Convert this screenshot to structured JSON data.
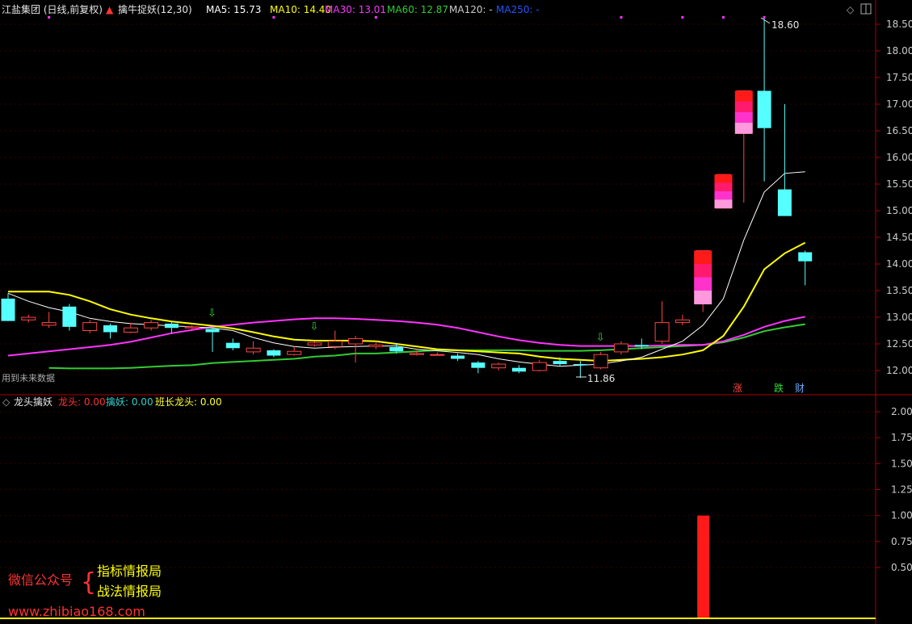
{
  "header": {
    "stock_title": "江盐集团 (日线,前复权)",
    "indicator_name": "擒牛捉妖(12,30)",
    "ma": [
      {
        "label": "MA5: 15.73",
        "color": "#ffffff"
      },
      {
        "label": "MA10: 14.40",
        "color": "#ffff00"
      },
      {
        "label": "MA30: 13.01",
        "color": "#ff33ff"
      },
      {
        "label": "MA60: 12.87",
        "color": "#33cc33"
      },
      {
        "label": "MA120: -",
        "color": "#cccccc"
      },
      {
        "label": "MA250: -",
        "color": "#2255ff"
      }
    ]
  },
  "main_panel": {
    "note": "用到未来数据",
    "high_label": "18.60",
    "low_label": "11.86",
    "tags": [
      {
        "text": "涨",
        "color": "#ff4444"
      },
      {
        "text": "跌",
        "color": "#33dd33"
      },
      {
        "text": "财",
        "color": "#66aaff"
      }
    ]
  },
  "sub_panel": {
    "title": "龙头擒妖",
    "items": [
      {
        "label": "龙头: 0.00",
        "color": "#ff3333"
      },
      {
        "label": "擒妖: 0.00",
        "color": "#33cccc"
      },
      {
        "label": "班长龙头: 0.00",
        "color": "#ffff33"
      }
    ]
  },
  "watermark": {
    "left_text": "微信公众号",
    "line1": "指标情报局",
    "line2": "战法情报局",
    "url": "www.zhibiao168.com"
  },
  "colors": {
    "up": "#ff4444",
    "down": "#55ffff",
    "border": "#aa0000",
    "axis_text": "#cccccc"
  },
  "chart_data": [
    {
      "type": "candlestick",
      "ylim": [
        11.7,
        18.75
      ],
      "yticks": [
        "12.00",
        "12.50",
        "13.00",
        "13.50",
        "14.00",
        "14.50",
        "15.00",
        "15.50",
        "16.00",
        "16.50",
        "17.00",
        "17.50",
        "18.00",
        "18.50"
      ],
      "candles": [
        {
          "o": 13.35,
          "h": 13.45,
          "l": 12.95,
          "c": 12.93
        },
        {
          "o": 12.95,
          "h": 13.05,
          "l": 12.9,
          "c": 13.0
        },
        {
          "o": 12.85,
          "h": 13.1,
          "l": 12.8,
          "c": 12.9
        },
        {
          "o": 13.2,
          "h": 13.25,
          "l": 12.75,
          "c": 12.82
        },
        {
          "o": 12.75,
          "h": 12.95,
          "l": 12.7,
          "c": 12.9
        },
        {
          "o": 12.85,
          "h": 12.88,
          "l": 12.6,
          "c": 12.72
        },
        {
          "o": 12.72,
          "h": 12.9,
          "l": 12.7,
          "c": 12.8
        },
        {
          "o": 12.8,
          "h": 12.95,
          "l": 12.75,
          "c": 12.9
        },
        {
          "o": 12.88,
          "h": 12.92,
          "l": 12.7,
          "c": 12.8
        },
        {
          "o": 12.8,
          "h": 12.85,
          "l": 12.78,
          "c": 12.82
        },
        {
          "o": 12.78,
          "h": 12.8,
          "l": 12.35,
          "c": 12.72
        },
        {
          "o": 12.52,
          "h": 12.6,
          "l": 12.38,
          "c": 12.42
        },
        {
          "o": 12.35,
          "h": 12.55,
          "l": 12.3,
          "c": 12.42
        },
        {
          "o": 12.38,
          "h": 12.4,
          "l": 12.25,
          "c": 12.28
        },
        {
          "o": 12.3,
          "h": 12.45,
          "l": 12.28,
          "c": 12.36
        },
        {
          "o": 12.48,
          "h": 12.55,
          "l": 12.45,
          "c": 12.52
        },
        {
          "o": 12.45,
          "h": 12.75,
          "l": 12.4,
          "c": 12.55
        },
        {
          "o": 12.5,
          "h": 12.65,
          "l": 12.15,
          "c": 12.6
        },
        {
          "o": 12.45,
          "h": 12.55,
          "l": 12.4,
          "c": 12.48
        },
        {
          "o": 12.44,
          "h": 12.5,
          "l": 12.32,
          "c": 12.36
        },
        {
          "o": 12.3,
          "h": 12.38,
          "l": 12.28,
          "c": 12.32
        },
        {
          "o": 12.3,
          "h": 12.34,
          "l": 12.28,
          "c": 12.3
        },
        {
          "o": 12.28,
          "h": 12.32,
          "l": 12.18,
          "c": 12.22
        },
        {
          "o": 12.15,
          "h": 12.18,
          "l": 11.95,
          "c": 12.05
        },
        {
          "o": 12.05,
          "h": 12.15,
          "l": 12.0,
          "c": 12.12
        },
        {
          "o": 12.05,
          "h": 12.1,
          "l": 11.95,
          "c": 11.98
        },
        {
          "o": 12.0,
          "h": 12.2,
          "l": 11.98,
          "c": 12.15
        },
        {
          "o": 12.18,
          "h": 12.25,
          "l": 12.08,
          "c": 12.12
        },
        {
          "o": 12.12,
          "h": 12.18,
          "l": 11.86,
          "c": 12.1
        },
        {
          "o": 12.05,
          "h": 12.35,
          "l": 12.02,
          "c": 12.3
        },
        {
          "o": 12.35,
          "h": 12.55,
          "l": 12.3,
          "c": 12.5
        },
        {
          "o": 12.48,
          "h": 12.6,
          "l": 12.4,
          "c": 12.45
        },
        {
          "o": 12.55,
          "h": 13.3,
          "l": 12.5,
          "c": 12.9
        },
        {
          "o": 12.9,
          "h": 13.05,
          "l": 12.85,
          "c": 12.95
        },
        {
          "o": 13.25,
          "h": 14.25,
          "l": 13.1,
          "c": 14.25
        },
        {
          "o": 15.05,
          "h": 15.68,
          "l": 15.05,
          "c": 15.68
        },
        {
          "o": 16.45,
          "h": 17.25,
          "l": 15.15,
          "c": 17.25
        },
        {
          "o": 17.25,
          "h": 18.6,
          "l": 15.55,
          "c": 16.55
        },
        {
          "o": 15.4,
          "h": 17.0,
          "l": 14.9,
          "c": 14.9
        },
        {
          "o": 14.22,
          "h": 14.25,
          "l": 13.6,
          "c": 14.05
        }
      ],
      "ma5": [
        13.45,
        13.3,
        13.18,
        13.1,
        12.98,
        12.92,
        12.88,
        12.86,
        12.84,
        12.82,
        12.8,
        12.75,
        12.62,
        12.52,
        12.45,
        12.42,
        12.44,
        12.45,
        12.46,
        12.46,
        12.4,
        12.37,
        12.34,
        12.3,
        12.22,
        12.16,
        12.12,
        12.08,
        12.1,
        12.12,
        12.18,
        12.25,
        12.4,
        12.55,
        12.85,
        13.35,
        14.45,
        15.35,
        15.7,
        15.73
      ],
      "ma10": [
        13.48,
        13.48,
        13.48,
        13.42,
        13.3,
        13.15,
        13.05,
        12.98,
        12.92,
        12.88,
        12.84,
        12.79,
        12.72,
        12.64,
        12.58,
        12.56,
        12.56,
        12.56,
        12.55,
        12.5,
        12.45,
        12.4,
        12.38,
        12.36,
        12.34,
        12.32,
        12.26,
        12.22,
        12.2,
        12.18,
        12.2,
        12.22,
        12.25,
        12.3,
        12.38,
        12.65,
        13.2,
        13.9,
        14.2,
        14.4
      ],
      "ma30": [
        12.28,
        12.32,
        12.36,
        12.4,
        12.44,
        12.48,
        12.54,
        12.62,
        12.7,
        12.76,
        12.82,
        12.86,
        12.9,
        12.93,
        12.96,
        12.98,
        12.98,
        12.97,
        12.95,
        12.93,
        12.9,
        12.86,
        12.8,
        12.72,
        12.64,
        12.57,
        12.52,
        12.48,
        12.46,
        12.46,
        12.46,
        12.46,
        12.47,
        12.48,
        12.48,
        12.55,
        12.67,
        12.82,
        12.93,
        13.01
      ],
      "ma60": [
        null,
        null,
        12.05,
        12.04,
        12.04,
        12.04,
        12.05,
        12.07,
        12.09,
        12.1,
        12.14,
        12.16,
        12.18,
        12.2,
        12.22,
        12.26,
        12.28,
        12.32,
        12.32,
        12.34,
        12.36,
        12.38,
        12.38,
        12.38,
        12.38,
        12.38,
        12.37,
        12.37,
        12.37,
        12.38,
        12.4,
        12.42,
        12.44,
        12.46,
        12.48,
        12.53,
        12.62,
        12.74,
        12.81,
        12.87
      ],
      "markers": [
        10,
        15,
        29
      ],
      "top_dots": [
        2,
        13,
        18,
        30,
        33,
        35,
        37
      ]
    },
    {
      "type": "bar",
      "ylim": [
        0,
        2.2
      ],
      "yticks": [
        "0.50",
        "0.75",
        "1.00",
        "1.25",
        "1.50",
        "1.75",
        "2.00"
      ],
      "bars": [
        {
          "index": 34,
          "value": 1.0
        }
      ]
    }
  ]
}
